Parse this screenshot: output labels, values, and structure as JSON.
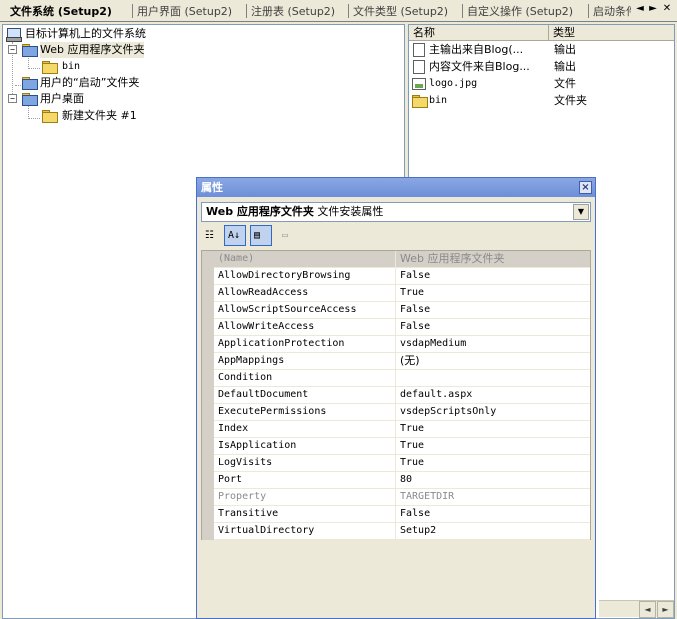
{
  "tabs": [
    {
      "label": "文件系统 (Setup2)",
      "active": true
    },
    {
      "label": "用户界面 (Setup2)"
    },
    {
      "label": "注册表 (Setup2)"
    },
    {
      "label": "文件类型 (Setup2)"
    },
    {
      "label": "自定义操作 (Setup2)"
    },
    {
      "label": "启动条件"
    }
  ],
  "tab_controls": {
    "prev": "◄",
    "next": "►",
    "close": "✕"
  },
  "tree": {
    "root": "目标计算机上的文件系统",
    "items": [
      {
        "label": "Web 应用程序文件夹",
        "selected": true
      },
      {
        "label": "bin"
      },
      {
        "label": "用户的“启动”文件夹"
      },
      {
        "label": "用户桌面"
      },
      {
        "label": "新建文件夹 #1"
      }
    ]
  },
  "list": {
    "columns": [
      "名称",
      "类型"
    ],
    "rows": [
      {
        "name": "主输出来自Blog(...",
        "type": "输出",
        "icon": "output-icon"
      },
      {
        "name": "内容文件来自Blog...",
        "type": "输出",
        "icon": "output-icon"
      },
      {
        "name": "logo.jpg",
        "type": "文件",
        "icon": "image-file-icon"
      },
      {
        "name": "bin",
        "type": "文件夹",
        "icon": "folder-icon"
      }
    ]
  },
  "properties": {
    "title": "属性",
    "object_name": "Web 应用程序文件夹",
    "object_desc": "文件安装属性",
    "rows": [
      {
        "name": "(Name)",
        "value": "Web 应用程序文件夹",
        "state": "selected"
      },
      {
        "name": "AllowDirectoryBrowsing",
        "value": "False"
      },
      {
        "name": "AllowReadAccess",
        "value": "True"
      },
      {
        "name": "AllowScriptSourceAccess",
        "value": "False"
      },
      {
        "name": "AllowWriteAccess",
        "value": "False"
      },
      {
        "name": "ApplicationProtection",
        "value": "vsdapMedium"
      },
      {
        "name": "AppMappings",
        "value": "(无)"
      },
      {
        "name": "Condition",
        "value": ""
      },
      {
        "name": "DefaultDocument",
        "value": "default.aspx"
      },
      {
        "name": "ExecutePermissions",
        "value": "vsdepScriptsOnly"
      },
      {
        "name": "Index",
        "value": "True"
      },
      {
        "name": "IsApplication",
        "value": "True"
      },
      {
        "name": "LogVisits",
        "value": "True"
      },
      {
        "name": "Port",
        "value": "80"
      },
      {
        "name": "Property",
        "value": "TARGETDIR",
        "state": "disabled"
      },
      {
        "name": "Transitive",
        "value": "False"
      },
      {
        "name": "VirtualDirectory",
        "value": "Setup2"
      }
    ]
  }
}
